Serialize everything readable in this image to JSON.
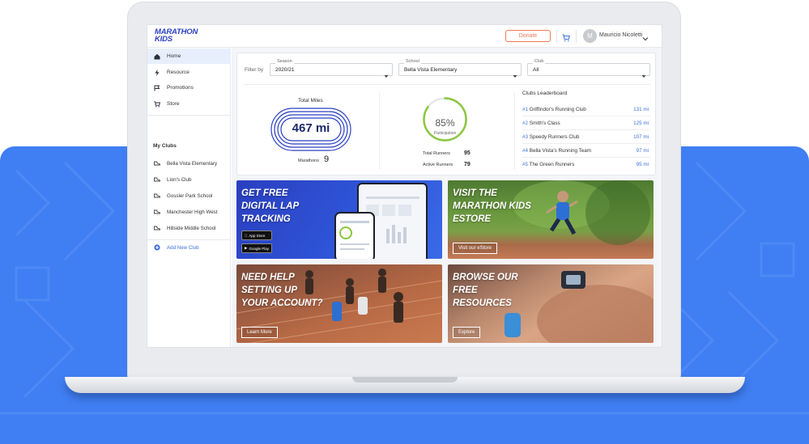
{
  "header": {
    "logo_line1": "MARATHON",
    "logo_line2": "KIDS",
    "donate_label": "Donate",
    "avatar_initial": "M",
    "user_name": "Mauricio Nicoletti"
  },
  "sidebar": {
    "nav": [
      {
        "label": "Home",
        "icon": "home-icon"
      },
      {
        "label": "Resource",
        "icon": "bolt-icon"
      },
      {
        "label": "Promotions",
        "icon": "flag-icon"
      },
      {
        "label": "Store",
        "icon": "cart-icon"
      }
    ],
    "my_clubs_heading": "My Clubs",
    "clubs": [
      "Bella Vista Elementary",
      "Lion's Club",
      "Gossler Park School",
      "Manchester High West",
      "Hillside Middle School"
    ],
    "add_club_label": "Add New Club"
  },
  "filters": {
    "label": "Filter by",
    "season": {
      "caption": "Season",
      "value": "2020/21"
    },
    "school": {
      "caption": "School",
      "value": "Bella Vista Elementary"
    },
    "club": {
      "caption": "Club",
      "value": "All"
    }
  },
  "stats": {
    "total_miles_title": "Total Miles",
    "total_miles_value": "467 mi",
    "marathons_label": "Marathons",
    "marathons_value": "9",
    "participation_pct": "85%",
    "participation_fraction": 0.85,
    "participation_label": "Participation",
    "total_runners_label": "Total Runners",
    "total_runners_value": "95",
    "active_runners_label": "Active Runners",
    "active_runners_value": "79"
  },
  "leaderboard": {
    "title": "Clubs Leaderboard",
    "rows": [
      {
        "rank": "#1",
        "name": "Griffindor's Running Club",
        "miles": "131 mi"
      },
      {
        "rank": "#2",
        "name": "Smith's Class",
        "miles": "125 mi"
      },
      {
        "rank": "#3",
        "name": "Speedy Runners Club",
        "miles": "107 mi"
      },
      {
        "rank": "#4",
        "name": "Bella Vista's Running Team",
        "miles": "97 mi"
      },
      {
        "rank": "#5",
        "name": "The Green Runners",
        "miles": "95 mi"
      }
    ]
  },
  "tiles": {
    "lap": {
      "line1": "GET FREE",
      "line2": "DIGITAL LAP",
      "line3": "TRACKING",
      "app_store": "App Store",
      "google_play": "Google Play"
    },
    "estore": {
      "line1": "VISIT THE",
      "line2": "MARATHON KIDS",
      "line3": "ESTORE",
      "button": "Visit our eStore"
    },
    "help": {
      "line1": "NEED HELP",
      "line2": "SETTING UP",
      "line3": "YOUR ACCOUNT?",
      "button": "Learn More"
    },
    "resources": {
      "line1": "BROWSE OUR",
      "line2": "FREE",
      "line3": "RESOURCES",
      "button": "Explore"
    }
  },
  "colors": {
    "accent_blue": "#3f7ef3",
    "brand_navy": "#2a3fc0",
    "donate_orange": "#f07a5a",
    "participation_green": "#8cc63f"
  }
}
